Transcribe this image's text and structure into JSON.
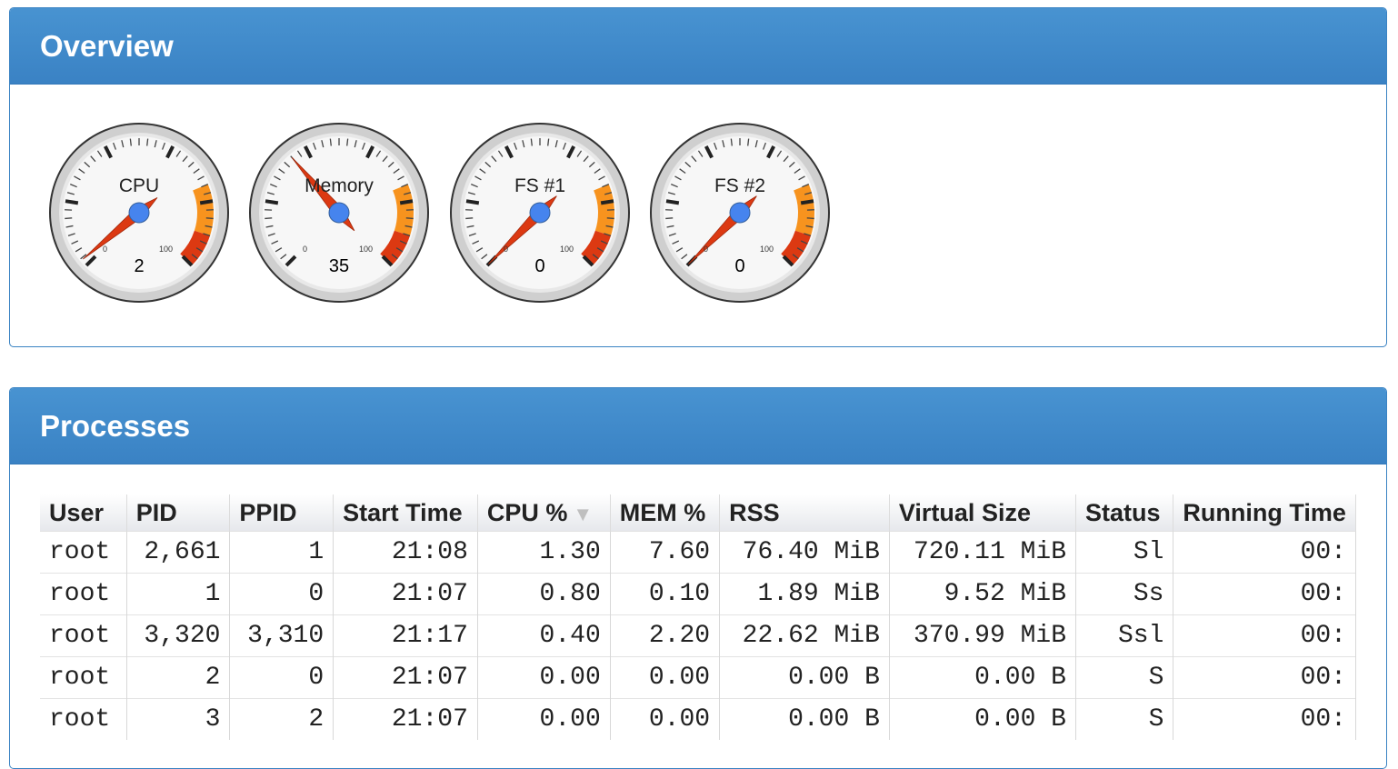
{
  "overview": {
    "title": "Overview",
    "gauges": [
      {
        "label": "CPU",
        "value": 2,
        "value_text": "2",
        "min": "0",
        "max": "100"
      },
      {
        "label": "Memory",
        "value": 35,
        "value_text": "35",
        "min": "0",
        "max": "100"
      },
      {
        "label": "FS #1",
        "value": 0,
        "value_text": "0",
        "min": "0",
        "max": "100"
      },
      {
        "label": "FS #2",
        "value": 0,
        "value_text": "0",
        "min": "0",
        "max": "100"
      }
    ],
    "colors": {
      "dial_face": "#f7f7f7",
      "orange_zone": "#f7931e",
      "red_zone": "#dc3912",
      "needle": "#dc3912",
      "hub": "#4684ee"
    }
  },
  "processes": {
    "title": "Processes",
    "columns": [
      "User",
      "PID",
      "PPID",
      "Start Time",
      "CPU %",
      "MEM %",
      "RSS",
      "Virtual Size",
      "Status",
      "Running Time"
    ],
    "sort_icon": "sort-desc-icon",
    "rows": [
      [
        "root",
        "2,661",
        "1",
        "21:08",
        "1.30",
        "7.60",
        "76.40 MiB",
        "720.11 MiB",
        "Sl",
        "00:"
      ],
      [
        "root",
        "1",
        "0",
        "21:07",
        "0.80",
        "0.10",
        "1.89 MiB",
        "9.52 MiB",
        "Ss",
        "00:"
      ],
      [
        "root",
        "3,320",
        "3,310",
        "21:17",
        "0.40",
        "2.20",
        "22.62 MiB",
        "370.99 MiB",
        "Ssl",
        "00:"
      ],
      [
        "root",
        "2",
        "0",
        "21:07",
        "0.00",
        "0.00",
        "0.00 B",
        "0.00 B",
        "S",
        "00:"
      ],
      [
        "root",
        "3",
        "2",
        "21:07",
        "0.00",
        "0.00",
        "0.00 B",
        "0.00 B",
        "S",
        "00:"
      ]
    ]
  }
}
